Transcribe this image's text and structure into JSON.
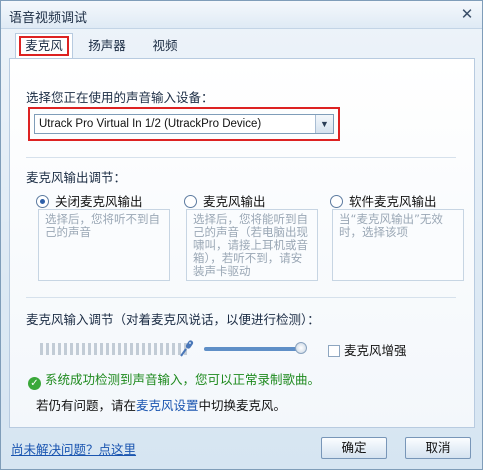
{
  "window": {
    "title": "语音视频调试",
    "close_glyph": "✕"
  },
  "tabs": [
    {
      "label": "麦克风",
      "active": true
    },
    {
      "label": "扬声器",
      "active": false
    },
    {
      "label": "视频",
      "active": false
    }
  ],
  "input_device": {
    "label": "选择您正在使用的声音输入设备：",
    "selected": "Utrack Pro Virtual In  1/2 (UtrackPro Device)",
    "arrow_glyph": "▼"
  },
  "output_adjust": {
    "label": "麦克风输出调节：",
    "options": [
      {
        "label": "关闭麦克风输出",
        "checked": true,
        "desc": "选择后，您将听不到自己的声音"
      },
      {
        "label": "麦克风输出",
        "checked": false,
        "desc": "选择后，您将能听到自己的声音（若电脑出现啸叫，请接上耳机或音箱），若听不到，请安装声卡驱动"
      },
      {
        "label": "软件麦克风输出",
        "checked": false,
        "desc": "当“麦克风输出”无效时，选择该项"
      }
    ]
  },
  "input_adjust": {
    "label": "麦克风输入调节（对着麦克风说话，以便进行检测）：",
    "volume_level": 0.97,
    "boost_label": "麦克风增强",
    "boost_checked": false
  },
  "status": {
    "ok_glyph": "✓",
    "success_text": "系统成功检测到声音输入，您可以正常录制歌曲。",
    "hint_prefix": "若仍有问题，请在",
    "hint_link": "麦克风设置",
    "hint_suffix": "中切换麦克风。"
  },
  "footer": {
    "help_link": "尚未解决问题？点这里",
    "ok_label": "确定",
    "cancel_label": "取消"
  },
  "colors": {
    "highlight_red": "#dd2222",
    "link_blue": "#1a55b0",
    "success_green": "#1e8a1e"
  }
}
